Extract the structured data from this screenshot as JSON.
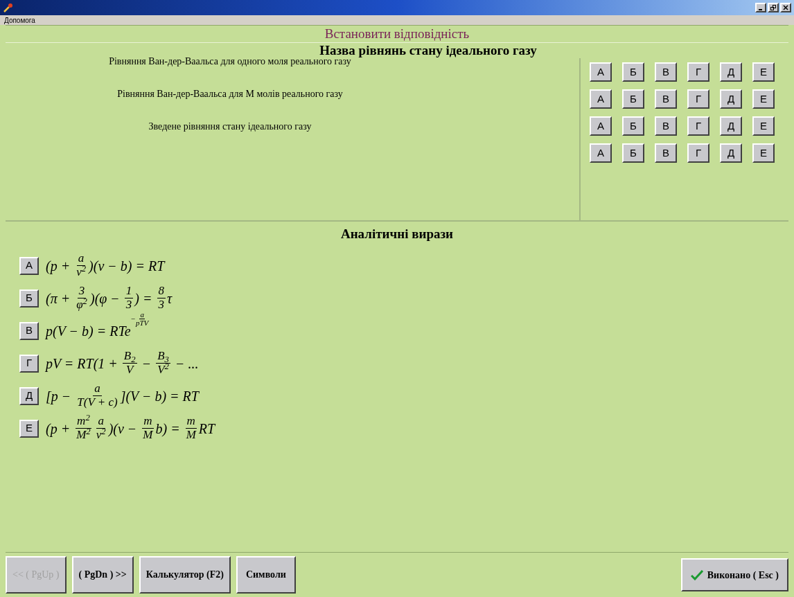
{
  "menu": [
    "Допомога"
  ],
  "header": "Встановити відповідність",
  "names_section": {
    "title": "Назва рівнянь стану ідеального газу",
    "statements": [
      "Рівняння Ван-дер-Ваальса для одного моля реального газу",
      "Рівняння Ван-дер-Ваальса для M молів реального газу",
      "Зведене рівняння стану ідеального газу"
    ],
    "answer_rows": [
      [
        "А",
        "Б",
        "В",
        "Г",
        "Д",
        "Е"
      ],
      [
        "А",
        "Б",
        "В",
        "Г",
        "Д",
        "Е"
      ],
      [
        "А",
        "Б",
        "В",
        "Г",
        "Д",
        "Е"
      ],
      [
        "А",
        "Б",
        "В",
        "Г",
        "Д",
        "Е"
      ]
    ]
  },
  "expressions_section": {
    "title": "Аналітичні вирази",
    "items": [
      {
        "letter": "А",
        "parts": [
          {
            "kind": "text",
            "text": "(p + "
          },
          {
            "kind": "frac",
            "num": "a",
            "den": "v$^{2}$"
          },
          {
            "kind": "text",
            "text": ")(v − b) = RT"
          }
        ]
      },
      {
        "letter": "Б",
        "parts": [
          {
            "kind": "text",
            "text": "(π + "
          },
          {
            "kind": "frac",
            "num": "3",
            "den": "φ$^{2}$"
          },
          {
            "kind": "text",
            "text": ")(φ − "
          },
          {
            "kind": "frac",
            "num": "1",
            "den": "3"
          },
          {
            "kind": "text",
            "text": ") = "
          },
          {
            "kind": "frac",
            "num": "8",
            "den": "3"
          },
          {
            "kind": "text",
            "text": "τ"
          }
        ]
      },
      {
        "letter": "В",
        "parts": [
          {
            "kind": "text",
            "text": "p(V − b) = RTe"
          },
          {
            "kind": "exp",
            "sign": "−",
            "num": "a",
            "den": "pTV"
          }
        ]
      },
      {
        "letter": "Г",
        "parts": [
          {
            "kind": "text",
            "text": "pV = RT(1 + "
          },
          {
            "kind": "frac",
            "num": "B$_{2}$",
            "den": "V"
          },
          {
            "kind": "text",
            "text": " − "
          },
          {
            "kind": "frac",
            "num": "B$_{3}$",
            "den": "V$^{2}$"
          },
          {
            "kind": "text",
            "text": " − ..."
          }
        ]
      },
      {
        "letter": "Д",
        "parts": [
          {
            "kind": "text",
            "text": "[p − "
          },
          {
            "kind": "frac",
            "num": "a",
            "den": "T(V + c)"
          },
          {
            "kind": "text",
            "text": "](V − b) = RT"
          }
        ]
      },
      {
        "letter": "Е",
        "parts": [
          {
            "kind": "text",
            "text": "(p + "
          },
          {
            "kind": "frac",
            "num": "m$^{2}$",
            "den": "M$^{2}$"
          },
          {
            "kind": "frac",
            "num": "a",
            "den": "v$^{2}$"
          },
          {
            "kind": "text",
            "text": ")(v − "
          },
          {
            "kind": "frac",
            "num": "m",
            "den": "M"
          },
          {
            "kind": "text",
            "text": "b) = "
          },
          {
            "kind": "frac",
            "num": "m",
            "den": "M"
          },
          {
            "kind": "text",
            "text": "RT"
          }
        ]
      }
    ]
  },
  "buttons": [
    {
      "label": "<< ( PgUp )",
      "disabled": true
    },
    {
      "label": "( PgDn ) >>",
      "disabled": false
    },
    {
      "label": "Калькулятор (F2)",
      "disabled": false
    },
    {
      "label": "Символи",
      "disabled": false
    }
  ],
  "done_button": {
    "label": "Виконано ( Esc )"
  }
}
